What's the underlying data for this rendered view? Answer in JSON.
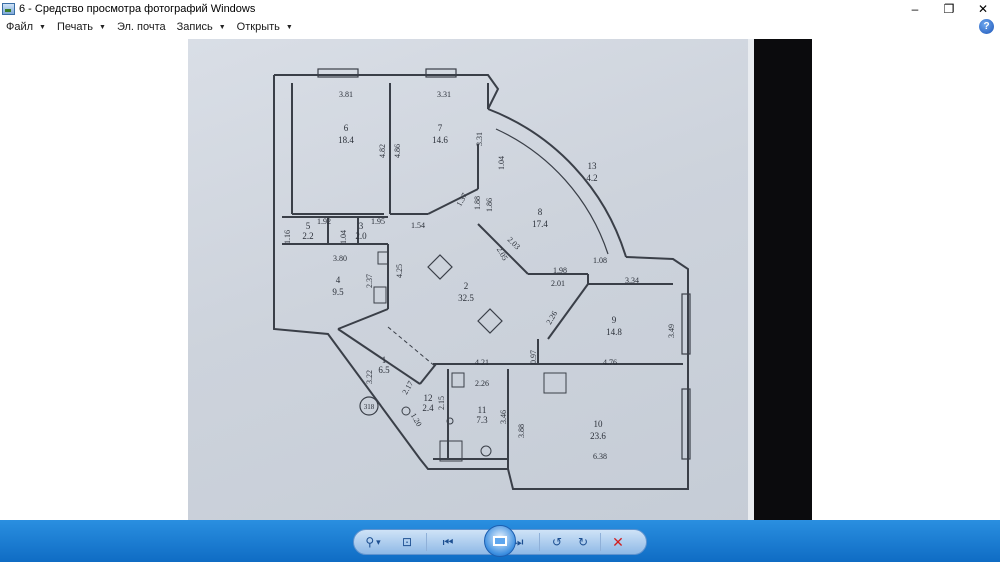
{
  "window": {
    "title": "6 - Средство просмотра фотографий Windows",
    "minimize": "–",
    "restore": "❐",
    "close": "✕"
  },
  "menu": {
    "items": [
      {
        "label": "Файл",
        "has_arrow": true
      },
      {
        "label": "Печать",
        "has_arrow": true
      },
      {
        "label": "Эл. почта",
        "has_arrow": false
      },
      {
        "label": "Запись",
        "has_arrow": true
      },
      {
        "label": "Открыть",
        "has_arrow": true
      }
    ],
    "arrow_glyph": "▼",
    "help": "?"
  },
  "plan": {
    "rooms": [
      {
        "num": "6",
        "area": "18.4"
      },
      {
        "num": "7",
        "area": "14.6"
      },
      {
        "num": "13",
        "area": "4.2"
      },
      {
        "num": "8",
        "area": "17.4"
      },
      {
        "num": "5",
        "area": "2.2"
      },
      {
        "num": "3",
        "area": "2.0"
      },
      {
        "num": "4",
        "area": "9.5"
      },
      {
        "num": "2",
        "area": "32.5"
      },
      {
        "num": "9",
        "area": "14.8"
      },
      {
        "num": "1",
        "area": "6.5"
      },
      {
        "num": "12",
        "area": "2.4"
      },
      {
        "num": "11",
        "area": "7.3"
      },
      {
        "num": "10",
        "area": "23.6"
      }
    ],
    "dims": [
      "3.81",
      "3.31",
      "4.82",
      "4.86",
      "3.31",
      "1.04",
      "1.37",
      "1.88",
      "1.86",
      "1.92",
      "1.95",
      "1.16",
      "1.04",
      "1.54",
      "3.80",
      "2.37",
      "4.25",
      "2.03",
      "2.05",
      "1.98",
      "1.08",
      "2.01",
      "3.34",
      "3.49",
      "2.26",
      "0.97",
      "4.21",
      "4.76",
      "2.26",
      "3.22",
      "2.17",
      "2.15",
      "1.20",
      "3.46",
      "3.88",
      "6.38"
    ],
    "stamp": "318"
  },
  "toolbar": {
    "zoom": "⚲",
    "zoom_arrow": "▾",
    "fit": "⊡",
    "prev": "⏮",
    "next": "⏭",
    "rotate_ccw": "↺",
    "rotate_cw": "↻",
    "delete": "✕"
  }
}
